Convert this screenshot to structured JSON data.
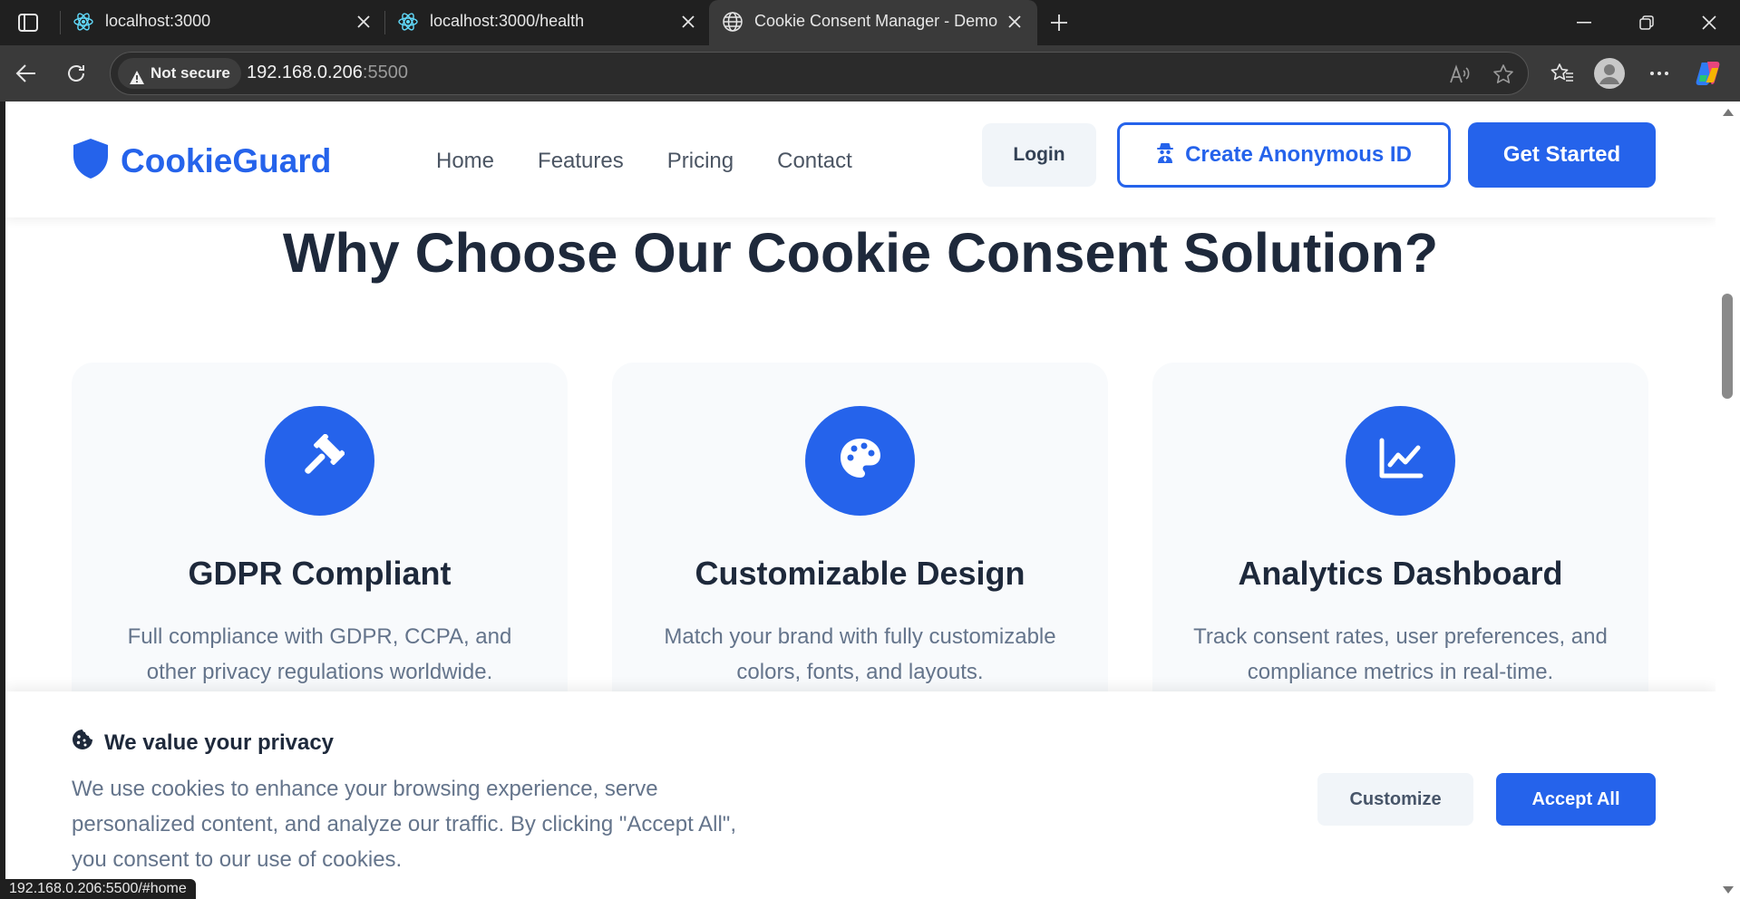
{
  "browser": {
    "tabs": [
      {
        "label": "localhost:3000",
        "icon": "react-icon"
      },
      {
        "label": "localhost:3000/health",
        "icon": "react-icon"
      },
      {
        "label": "Cookie Consent Manager - Demo",
        "icon": "globe-icon"
      }
    ],
    "security_label": "Not secure",
    "url_host": "192.168.0.206",
    "url_port": ":5500",
    "status_url": "192.168.0.206:5500/#home"
  },
  "site": {
    "brand": "CookieGuard",
    "nav": [
      "Home",
      "Features",
      "Pricing",
      "Contact"
    ],
    "login_label": "Login",
    "anon_label": "Create Anonymous ID",
    "start_label": "Get Started",
    "section_title": "Why Choose Our Cookie Consent Solution?",
    "features": [
      {
        "icon": "gavel-icon",
        "title": "GDPR Compliant",
        "desc": "Full compliance with GDPR, CCPA, and other privacy regulations worldwide."
      },
      {
        "icon": "palette-icon",
        "title": "Customizable Design",
        "desc": "Match your brand with fully customizable colors, fonts, and layouts."
      },
      {
        "icon": "chart-line-icon",
        "title": "Analytics Dashboard",
        "desc": "Track consent rates, user preferences, and compliance metrics in real-time."
      }
    ],
    "cookie_banner": {
      "title": "We value your privacy",
      "text": "We use cookies to enhance your browsing experience, serve personalized content, and analyze our traffic. By clicking \"Accept All\", you consent to our use of cookies.",
      "customize_label": "Customize",
      "accept_label": "Accept All"
    }
  },
  "colors": {
    "brand": "#2563eb",
    "heading": "#1e293b",
    "muted": "#64748b"
  }
}
